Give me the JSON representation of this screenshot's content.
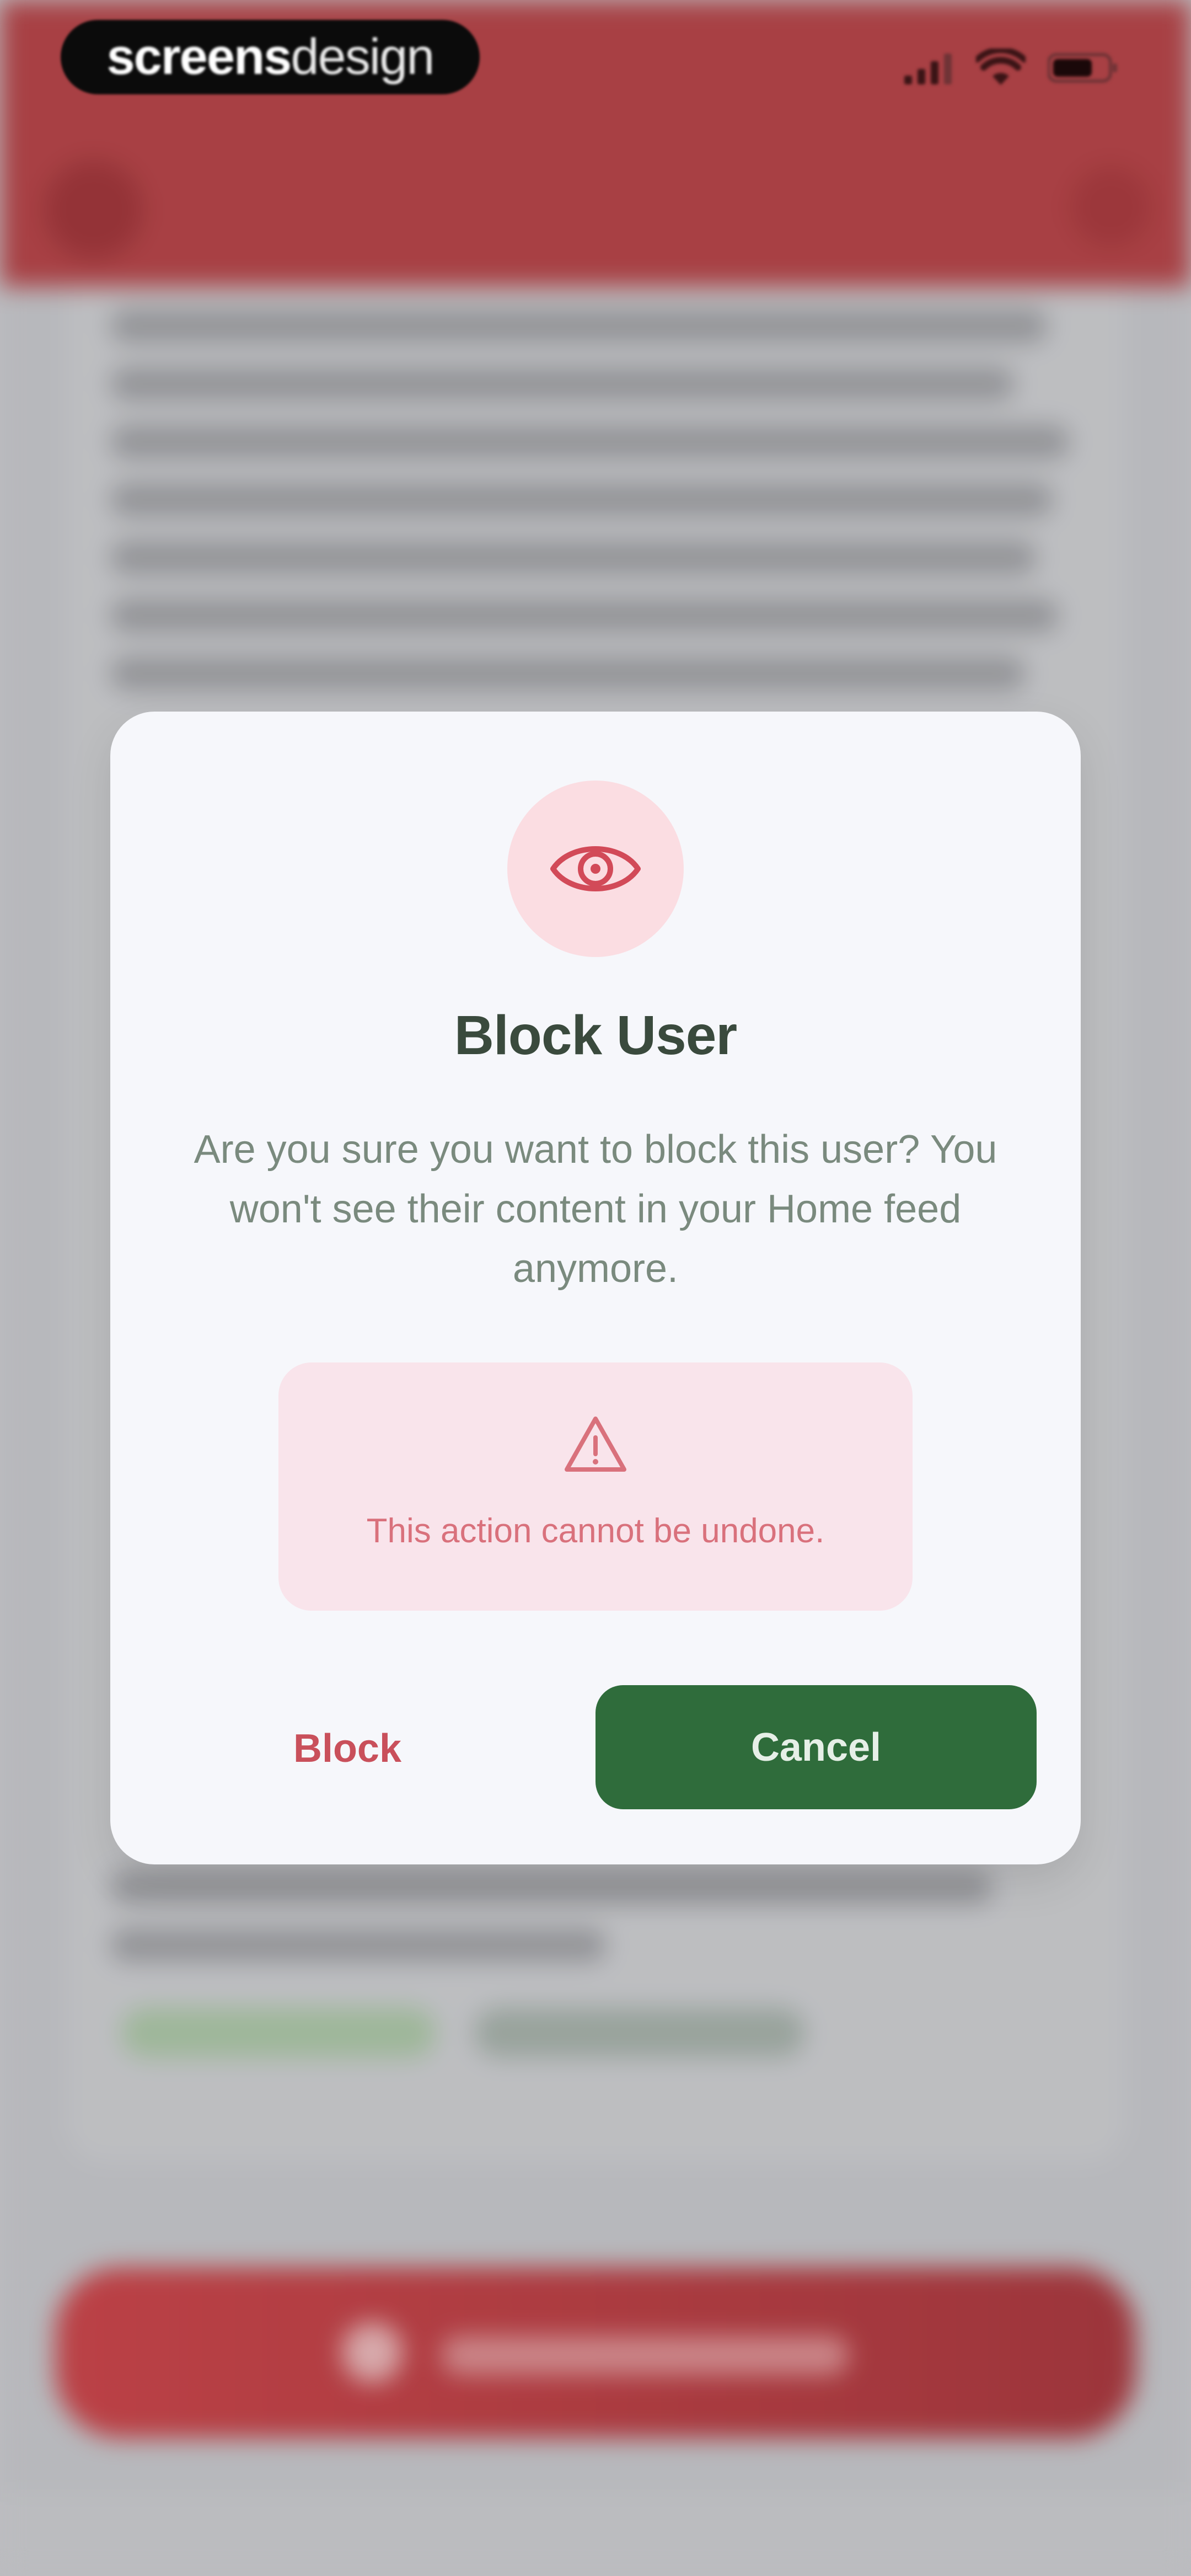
{
  "status_bar": {
    "brand_strong": "screens",
    "brand_light": "design",
    "icons": [
      "signal-icon",
      "wifi-icon",
      "battery-icon"
    ]
  },
  "dialog": {
    "icon": "eye-icon",
    "title": "Block User",
    "message": "Are you sure you want to block this user? You won't see their content in your Home feed anymore.",
    "warning": {
      "icon": "warning-triangle-icon",
      "text": "This action cannot be undone."
    },
    "block_label": "Block",
    "cancel_label": "Cancel"
  },
  "colors": {
    "header_red": "#b34346",
    "dialog_background": "#f6f7fb",
    "icon_circle": "#fbdde2",
    "accent_red": "#c9505b",
    "warning_background": "#f9e4eb",
    "cancel_green": "#2f6c3b",
    "title_text": "#3a4a3d"
  }
}
